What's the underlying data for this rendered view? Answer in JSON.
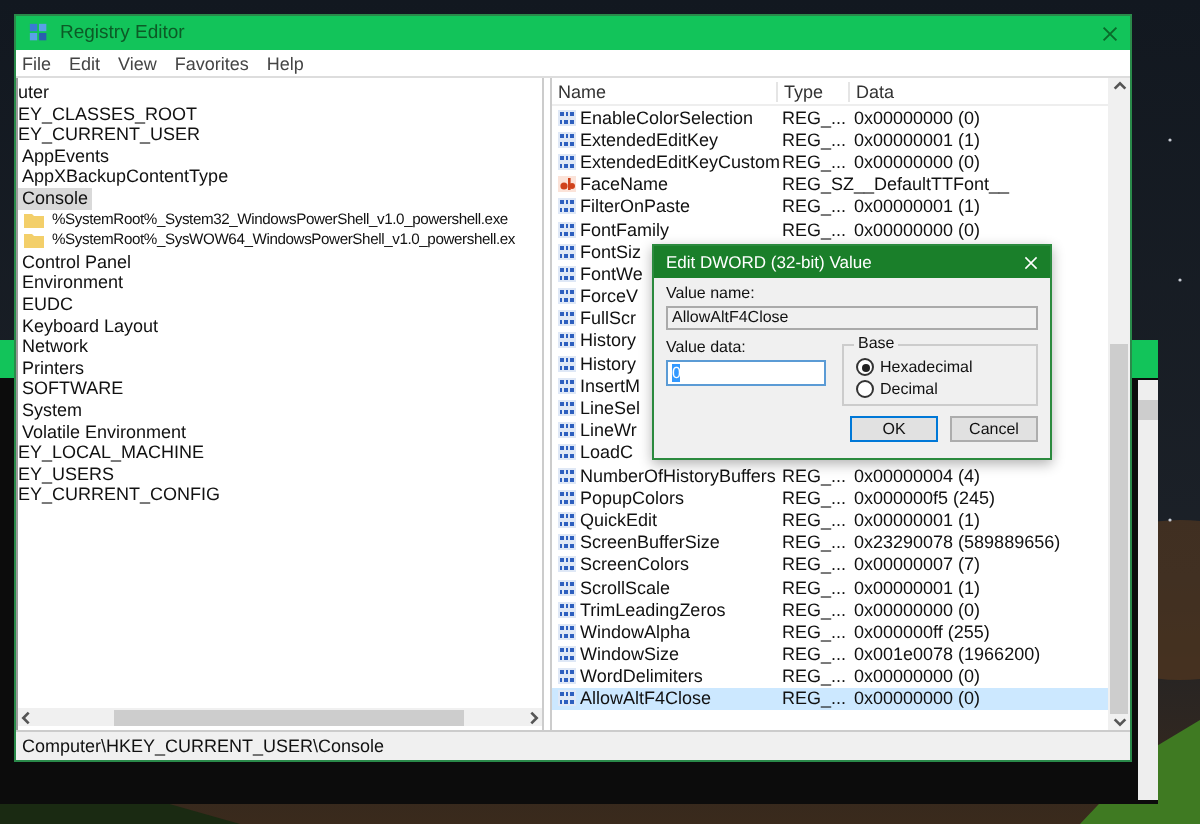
{
  "window": {
    "title": "Registry Editor"
  },
  "menu": [
    "File",
    "Edit",
    "View",
    "Favorites",
    "Help"
  ],
  "tree": [
    {
      "label": "uter",
      "selected": false,
      "children": [
        {
          "label": "EY_CLASSES_ROOT",
          "selected": false
        },
        {
          "label": "EY_CURRENT_USER",
          "selected": false,
          "children": [
            {
              "label": "AppEvents",
              "selected": false
            },
            {
              "label": "AppXBackupContentType",
              "selected": false
            },
            {
              "label": "Console",
              "selected": true,
              "children": [
                {
                  "label": "%SystemRoot%_System32_WindowsPowerShell_v1.0_powershell.exe",
                  "selected": false
                },
                {
                  "label": "%SystemRoot%_SysWOW64_WindowsPowerShell_v1.0_powershell.ex",
                  "selected": false
                }
              ]
            },
            {
              "label": "Control Panel",
              "selected": false
            },
            {
              "label": "Environment",
              "selected": false
            },
            {
              "label": "EUDC",
              "selected": false
            },
            {
              "label": "Keyboard Layout",
              "selected": false
            },
            {
              "label": "Network",
              "selected": false
            },
            {
              "label": "Printers",
              "selected": false
            },
            {
              "label": "SOFTWARE",
              "selected": false
            },
            {
              "label": "System",
              "selected": false
            },
            {
              "label": "Volatile Environment",
              "selected": false
            }
          ]
        },
        {
          "label": "EY_LOCAL_MACHINE",
          "selected": false
        },
        {
          "label": "EY_USERS",
          "selected": false
        },
        {
          "label": "EY_CURRENT_CONFIG",
          "selected": false
        }
      ]
    }
  ],
  "columns": [
    "Name",
    "Type",
    "Data"
  ],
  "values": [
    {
      "kind": "dword",
      "name": "EnableColorSelection",
      "type": "REG_...",
      "data": "0x00000000 (0)",
      "selected": false
    },
    {
      "kind": "dword",
      "name": "ExtendedEditKey",
      "type": "REG_...",
      "data": "0x00000001 (1)",
      "selected": false
    },
    {
      "kind": "dword",
      "name": "ExtendedEditKeyCustom",
      "type": "REG_...",
      "data": "0x00000000 (0)",
      "selected": false
    },
    {
      "kind": "string",
      "name": "FaceName",
      "type": "REG_SZ",
      "data": "__DefaultTTFont__",
      "selected": false
    },
    {
      "kind": "dword",
      "name": "FilterOnPaste",
      "type": "REG_...",
      "data": "0x00000001 (1)",
      "selected": false
    },
    {
      "kind": "dword",
      "name": "FontFamily",
      "type": "REG_...",
      "data": "0x00000000 (0)",
      "selected": false
    },
    {
      "kind": "dword",
      "name": "FontSiz",
      "selected": false
    },
    {
      "kind": "dword",
      "name": "FontWe",
      "selected": false
    },
    {
      "kind": "dword",
      "name": "ForceV",
      "selected": false
    },
    {
      "kind": "dword",
      "name": "FullScr",
      "selected": false
    },
    {
      "kind": "dword",
      "name": "History",
      "selected": false
    },
    {
      "kind": "dword",
      "name": "History",
      "selected": false
    },
    {
      "kind": "dword",
      "name": "InsertM",
      "selected": false
    },
    {
      "kind": "dword",
      "name": "LineSel",
      "selected": false
    },
    {
      "kind": "dword",
      "name": "LineWr",
      "selected": false
    },
    {
      "kind": "dword",
      "name": "LoadC",
      "selected": false
    },
    {
      "kind": "dword",
      "name": "NumberOfHistoryBuffers",
      "type": "REG_...",
      "data": "0x00000004 (4)",
      "selected": false
    },
    {
      "kind": "dword",
      "name": "PopupColors",
      "type": "REG_...",
      "data": "0x000000f5 (245)",
      "selected": false
    },
    {
      "kind": "dword",
      "name": "QuickEdit",
      "type": "REG_...",
      "data": "0x00000001 (1)",
      "selected": false
    },
    {
      "kind": "dword",
      "name": "ScreenBufferSize",
      "type": "REG_...",
      "data": "0x23290078 (589889656)",
      "selected": false
    },
    {
      "kind": "dword",
      "name": "ScreenColors",
      "type": "REG_...",
      "data": "0x00000007 (7)",
      "selected": false
    },
    {
      "kind": "dword",
      "name": "ScrollScale",
      "type": "REG_...",
      "data": "0x00000001 (1)",
      "selected": false
    },
    {
      "kind": "dword",
      "name": "TrimLeadingZeros",
      "type": "REG_...",
      "data": "0x00000000 (0)",
      "selected": false
    },
    {
      "kind": "dword",
      "name": "WindowAlpha",
      "type": "REG_...",
      "data": "0x000000ff (255)",
      "selected": false
    },
    {
      "kind": "dword",
      "name": "WindowSize",
      "type": "REG_...",
      "data": "0x001e0078 (1966200)",
      "selected": false
    },
    {
      "kind": "dword",
      "name": "WordDelimiters",
      "type": "REG_...",
      "data": "0x00000000 (0)",
      "selected": false
    },
    {
      "kind": "dword",
      "name": "AllowAltF4Close",
      "type": "REG_...",
      "data": "0x00000000 (0)",
      "selected": true
    }
  ],
  "dialog": {
    "title": "Edit DWORD (32-bit) Value",
    "value_name_label": "Value name:",
    "value_name": "AllowAltF4Close",
    "value_data_label": "Value data:",
    "value_data": "0",
    "base_label": "Base",
    "bases": [
      {
        "label": "Hexadecimal",
        "selected": true
      },
      {
        "label": "Decimal",
        "selected": false
      }
    ],
    "buttons": [
      {
        "label": "OK",
        "default": true
      },
      {
        "label": "Cancel",
        "default": false
      }
    ]
  },
  "status_bar": "Computer\\HKEY_CURRENT_USER\\Console"
}
